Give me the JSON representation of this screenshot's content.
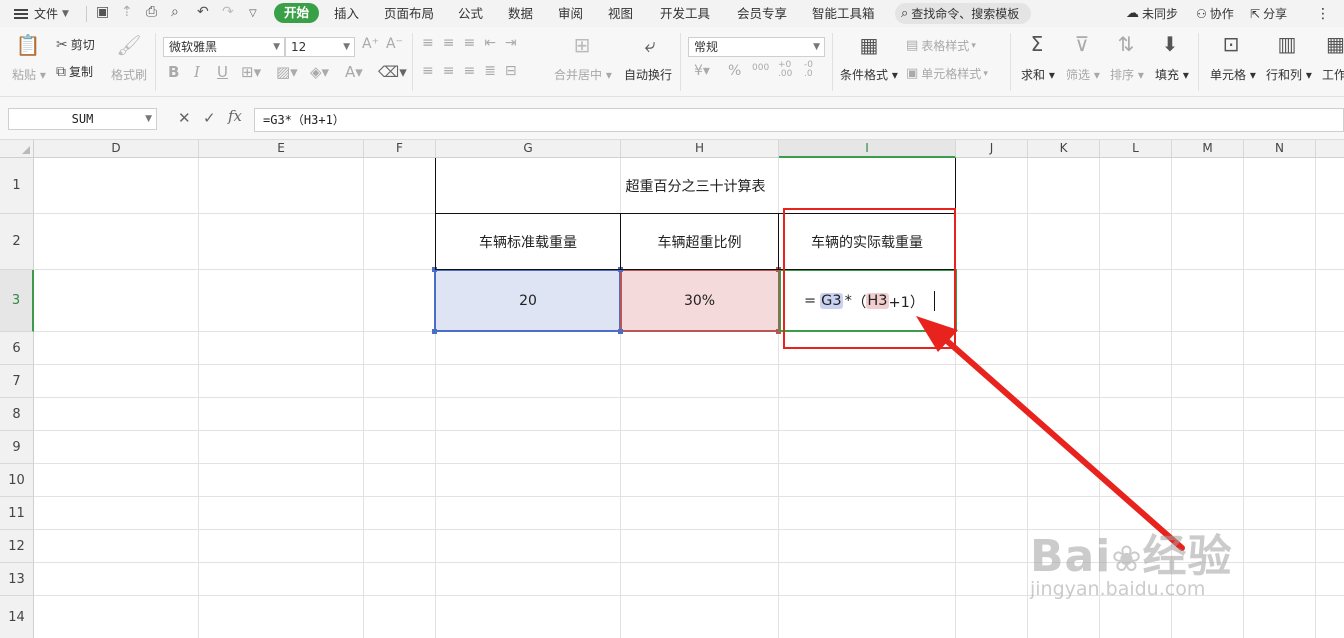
{
  "menubar": {
    "file": "文件",
    "tabs": [
      "开始",
      "插入",
      "页面布局",
      "公式",
      "数据",
      "审阅",
      "视图",
      "开发工具",
      "会员专享",
      "智能工具箱"
    ],
    "active_tab": "开始",
    "search_placeholder": "查找命令、搜索模板",
    "sync": "未同步",
    "collab": "协作",
    "share": "分享"
  },
  "ribbon": {
    "paste": "粘贴",
    "cut": "剪切",
    "copy": "复制",
    "format_painter": "格式刷",
    "font_name": "微软雅黑",
    "font_size": "12",
    "merge_center": "合并居中",
    "wrap_text": "自动换行",
    "number_format": "常规",
    "conditional_format": "条件格式",
    "table_style": "表格样式",
    "cell_style": "单元格样式",
    "sum": "求和",
    "filter": "筛选",
    "sort": "排序",
    "fill": "填充",
    "cell": "单元格",
    "row_col": "行和列",
    "worksheet": "工作"
  },
  "formula_bar": {
    "name_box": "SUM",
    "formula": "=G3*（H3+1）"
  },
  "grid": {
    "columns": [
      "D",
      "E",
      "F",
      "G",
      "H",
      "I",
      "J",
      "K",
      "L",
      "M",
      "N"
    ],
    "selected_column": "I",
    "rows": [
      "1",
      "2",
      "3",
      "6",
      "7",
      "8",
      "9",
      "10",
      "11",
      "12",
      "13",
      "14"
    ],
    "selected_row": "3"
  },
  "table": {
    "title": "超重百分之三十计算表",
    "headers": [
      "车辆标准载重量",
      "车辆超重比例",
      "车辆的实际载重量"
    ],
    "values": [
      "20",
      "30%"
    ],
    "edit_formula": {
      "eq": "=",
      "ref1": "G3",
      "op": "*",
      "lparen": "（",
      "ref2": "H3",
      "plus": "+1）"
    }
  },
  "watermark": {
    "brand": "Bai",
    "brand2": "经验",
    "url": "jingyan.baidu.com"
  },
  "colors": {
    "accent_green": "#3aa047",
    "ref_blue": "#4a6ec6",
    "ref_red": "#b85555",
    "annotation_red": "#e8221d"
  }
}
